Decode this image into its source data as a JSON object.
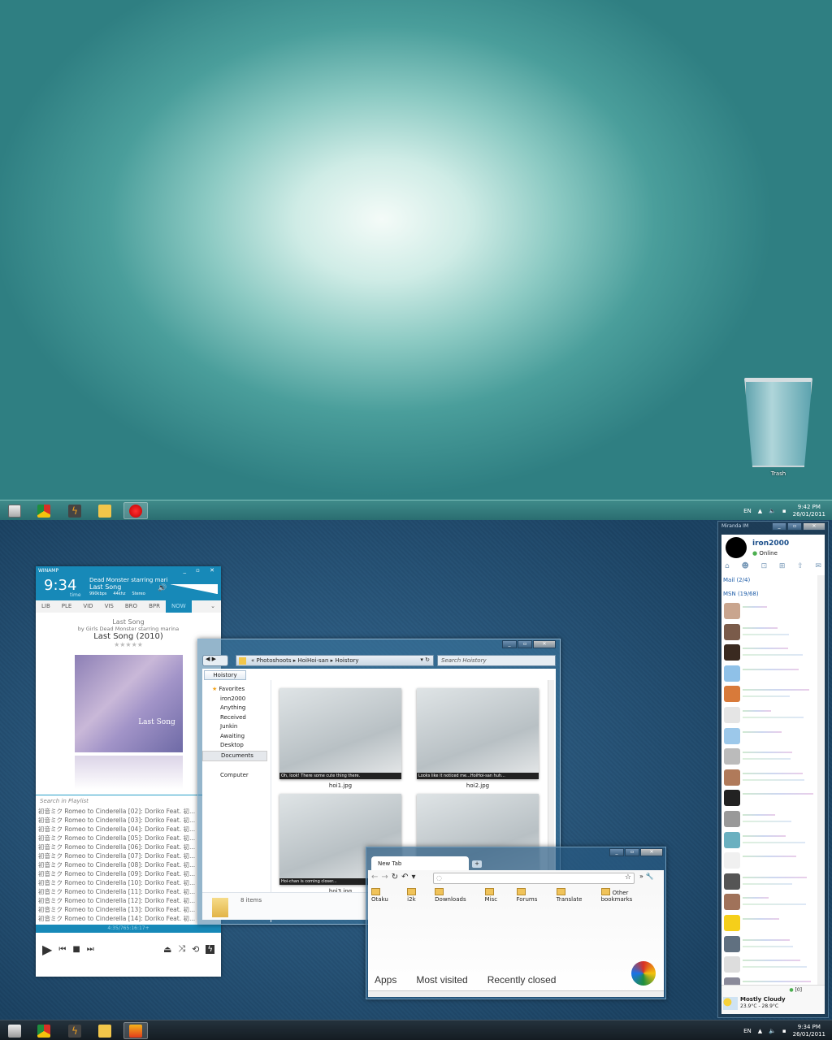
{
  "top_screen": {
    "desktop_icons": [
      {
        "label": "Trash",
        "icon": "recycle-bin-icon"
      }
    ],
    "taskbar": {
      "start_icon": "windows-orb-icon",
      "pinned": [
        {
          "name": "chrome",
          "icon": "chrome-icon",
          "color": "#d93025"
        },
        {
          "name": "winamp",
          "icon": "lightning-icon",
          "color": "#f0a020"
        },
        {
          "name": "explorer",
          "icon": "folder-icon",
          "color": "#f2c64a"
        },
        {
          "name": "miranda",
          "icon": "miranda-flower-icon",
          "color": "#e01010"
        }
      ],
      "tray": {
        "lang": "EN",
        "time": "9:42 PM",
        "date": "26/01/2011"
      }
    }
  },
  "bottom_screen": {
    "taskbar": {
      "tray": {
        "lang": "EN",
        "time": "9:34 PM",
        "date": "26/01/2011"
      }
    },
    "winamp": {
      "title": "WINAMP",
      "time": "9:34",
      "time_label": "time",
      "scroll_title": "Dead Monster starring mari",
      "track": "Last Song",
      "bitrate": "990kbps",
      "samplerate": "44khz",
      "channels": "Stereo",
      "tabs": [
        "LIB",
        "PLE",
        "VID",
        "VIS",
        "BRO",
        "BPR",
        "NOW"
      ],
      "active_tab": "NOW",
      "now_playing": {
        "title": "Last Song",
        "artist": "by Girls Dead Monster starring marina",
        "album": "Last Song (2010)",
        "rating": "★★★★★",
        "cover_text": "Last Song"
      },
      "playlist_search_placeholder": "Search in Playlist",
      "playlist": [
        "初音ミク Romeo to Cinderella [02]:  Doriko Feat. 初...",
        "初音ミク Romeo to Cinderella [03]:  Doriko Feat. 初...",
        "初音ミク Romeo to Cinderella [04]:  Doriko Feat. 初...",
        "初音ミク Romeo to Cinderella [05]:  Doriko Feat. 初...",
        "初音ミク Romeo to Cinderella [06]:  Doriko Feat. 初...",
        "初音ミク Romeo to Cinderella [07]:  Doriko Feat. 初...",
        "初音ミク Romeo to Cinderella [08]:  Doriko Feat. 初...",
        "初音ミク Romeo to Cinderella [09]:  Doriko Feat. 初...",
        "初音ミク Romeo to Cinderella [10]:  Doriko Feat. 初...",
        "初音ミク Romeo to Cinderella [11]:  Doriko Feat. 初...",
        "初音ミク Romeo to Cinderella [12]:  Doriko Feat. 初...",
        "初音ミク Romeo to Cinderella [13]:  Doriko Feat. 初...",
        "初音ミク Romeo to Cinderella [14]:  Doriko Feat. 初..."
      ],
      "status": "4:35/765:16:17+",
      "controls": {
        "play": "▶",
        "prev": "⏮",
        "stop": "■",
        "next": "⏭",
        "eject": "⏏",
        "shuffle": "⤨",
        "repeat": "⟲",
        "lightning": "ϟ"
      }
    },
    "explorer": {
      "breadcrumb": [
        "Photoshoots",
        "HoiHoi-san",
        "Hoistory"
      ],
      "search_placeholder": "Search Hoistory",
      "tab": "Hoistory",
      "nav": {
        "favorites": "Favorites",
        "items": [
          "iron2000",
          "Anything",
          "Received",
          "Junkin",
          "Awaiting",
          "Desktop",
          "Documents"
        ],
        "selected": "Documents",
        "computer": "Computer"
      },
      "files": [
        {
          "name": "hoi1.jpg",
          "caption": "Oh, look! There some cute thing there."
        },
        {
          "name": "hoi2.jpg",
          "caption": "Looks like it noticed me...HoiHoi-san huh..."
        },
        {
          "name": "hoi3.jpg",
          "caption": "Hoi-chan is coming closer..."
        },
        {
          "name": "",
          "caption": ""
        }
      ],
      "status": "8 items"
    },
    "chrome": {
      "tab": "New Tab",
      "bookmarks": [
        "Otaku",
        "i2k",
        "Downloads",
        "Misc",
        "Forums",
        "Translate"
      ],
      "other_bookmarks": "Other bookmarks",
      "ntp_sections": [
        "Apps",
        "Most visited",
        "Recently closed"
      ]
    },
    "miranda": {
      "title": "Miranda IM",
      "user": "iron2000",
      "status": "Online",
      "groups": [
        {
          "label": "Mail (2/4)"
        },
        {
          "label": "MSN (19/68)"
        }
      ],
      "contact_count": 19,
      "unread": "[0]",
      "weather": {
        "condition": "Mostly Cloudy",
        "temp": "23.9°C - 28.9°C"
      }
    }
  }
}
